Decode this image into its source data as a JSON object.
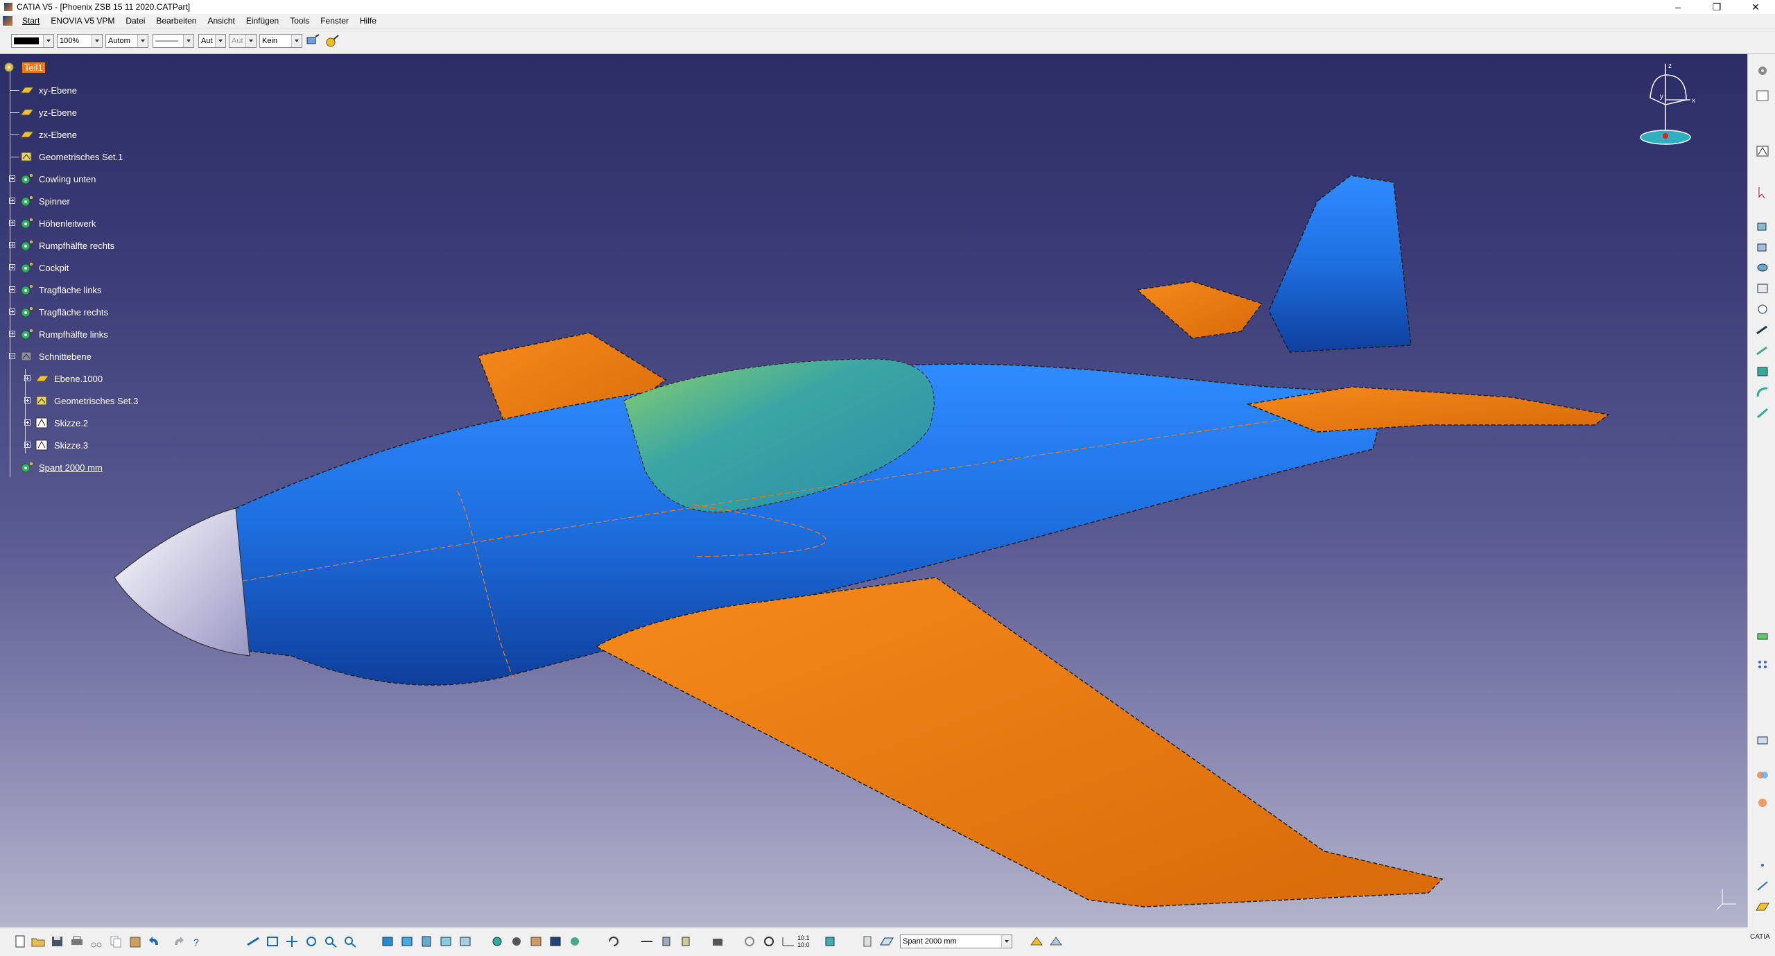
{
  "window": {
    "title": "CATIA V5 - [Phoenix ZSB 15 11 2020.CATPart]",
    "controls": [
      "–",
      "❐",
      "✕"
    ]
  },
  "menu": [
    "Start",
    "ENOVIA V5 VPM",
    "Datei",
    "Bearbeiten",
    "Ansicht",
    "Einfügen",
    "Tools",
    "Fenster",
    "Hilfe"
  ],
  "properties_toolbar": {
    "color": "#000000",
    "transparency": "100%",
    "line_weight": "Autom",
    "line_type": "———",
    "point_style": "Aut",
    "layer_disabled": "Aut",
    "layer": "Kein"
  },
  "tree": {
    "root": "Teil1",
    "items": [
      {
        "label": "xy-Ebene",
        "icon": "plane-icon",
        "expandable": false
      },
      {
        "label": "yz-Ebene",
        "icon": "plane-icon",
        "expandable": false
      },
      {
        "label": "zx-Ebene",
        "icon": "plane-icon",
        "expandable": false
      },
      {
        "label": "Geometrisches Set.1",
        "icon": "geometric-set-icon",
        "expandable": false
      },
      {
        "label": "Cowling unten",
        "icon": "body-icon",
        "expandable": true
      },
      {
        "label": "Spinner",
        "icon": "body-icon",
        "expandable": true
      },
      {
        "label": "Höhenleitwerk",
        "icon": "body-icon",
        "expandable": true
      },
      {
        "label": "Rumpfhälfte rechts",
        "icon": "body-icon",
        "expandable": true
      },
      {
        "label": "Cockpit",
        "icon": "body-icon",
        "expandable": true
      },
      {
        "label": "Tragfläche links",
        "icon": "body-icon",
        "expandable": true
      },
      {
        "label": "Tragfläche rechts",
        "icon": "body-icon",
        "expandable": true
      },
      {
        "label": "Rumpfhälfte links",
        "icon": "body-icon",
        "expandable": true
      },
      {
        "label": "Schnittebene",
        "icon": "geometric-set-hidden-icon",
        "expandable": true,
        "expanded": true
      },
      {
        "label": "Ebene.1000",
        "icon": "plane-icon",
        "expandable": true,
        "child": true
      },
      {
        "label": "Geometrisches Set.3",
        "icon": "geometric-set-icon",
        "expandable": true,
        "child": true
      },
      {
        "label": "Skizze.2",
        "icon": "sketch-icon",
        "expandable": true,
        "child": true
      },
      {
        "label": "Skizze.3",
        "icon": "sketch-icon",
        "expandable": true,
        "child": true
      },
      {
        "label": "Spant 2000 mm",
        "icon": "body-icon",
        "expandable": false,
        "underline": true
      }
    ]
  },
  "compass": {
    "axes": [
      "x",
      "y",
      "z"
    ]
  },
  "bottom_toolbar": {
    "current_plane": "Spant 2000 mm",
    "scale_label": "10.1\n10.0"
  },
  "brand": "CATIA",
  "colors": {
    "fuselage": "#1e6fe0",
    "wing": "#f07a14",
    "canopy": "#3aa6a4",
    "spinner": "#c8c4e0",
    "background_top": "#2c2c66",
    "background_bottom": "#b4b4cc",
    "tree_root": "#f07a14"
  }
}
